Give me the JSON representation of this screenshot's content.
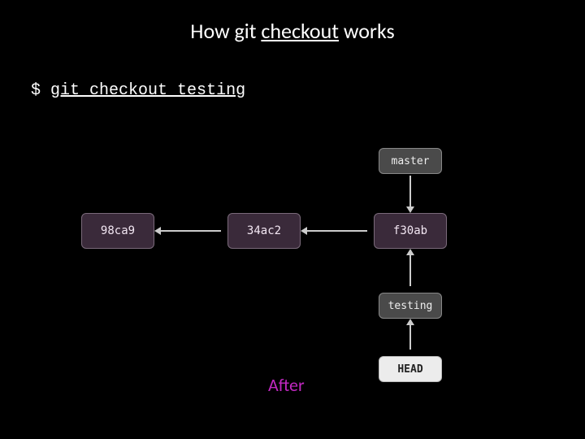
{
  "title": {
    "pre": "How git ",
    "underlined": "checkout",
    "post": " works"
  },
  "command": {
    "prompt": "$",
    "text": "git checkout testing"
  },
  "diagram": {
    "commits": {
      "c1": "98ca9",
      "c2": "34ac2",
      "c3": "f30ab"
    },
    "branches": {
      "master": "master",
      "testing": "testing"
    },
    "head_label": "HEAD",
    "after_label": "After"
  }
}
